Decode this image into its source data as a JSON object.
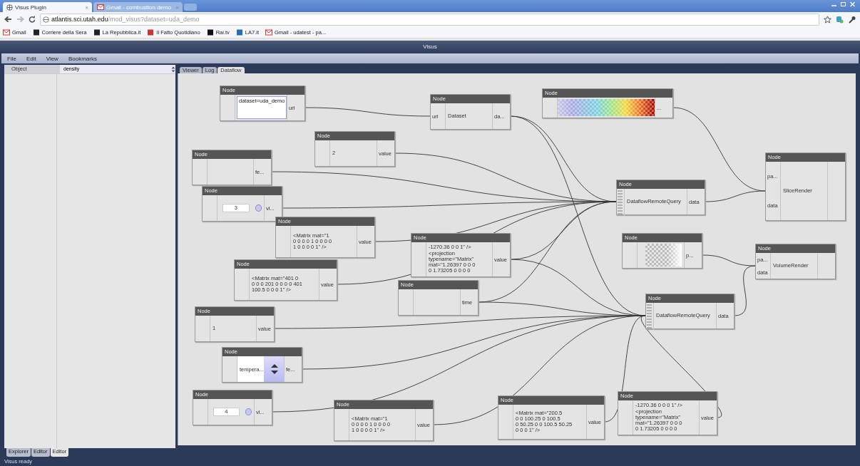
{
  "browser": {
    "tabs": [
      {
        "title": "Visus Plugin",
        "close": "×",
        "selected": true
      },
      {
        "title": "Gmail - combustion demo",
        "close": "×",
        "selected": false
      }
    ],
    "url": {
      "host": "atlantis.sci.utah.edu",
      "path": "/mod_visus?dataset=uda_demo"
    },
    "bookmarks": [
      "Gmail",
      "Corriere della Sera",
      "La Repubblica.it",
      "Il Fatto Quotidiano",
      "Rai.tv",
      "LA7.it",
      "Gmail - udatest - pa..."
    ]
  },
  "app": {
    "title": "Visus",
    "menu": [
      "File",
      "Edit",
      "View",
      "Bookmarks"
    ],
    "sidebar": {
      "property": "Object",
      "value": "density",
      "tabs": [
        {
          "label": "Explorer",
          "selected": false
        },
        {
          "label": "Editor",
          "selected": false
        },
        {
          "label": "Editor",
          "selected": true
        }
      ]
    },
    "view_tabs": [
      {
        "label": "Viewer",
        "selected": false
      },
      {
        "label": "Log",
        "selected": false
      },
      {
        "label": "Dataflow",
        "selected": true
      }
    ],
    "nodes": [
      {
        "kind": "field",
        "title": "Node",
        "value": "dataset=uda_demo",
        "output": "url"
      },
      {
        "kind": "label",
        "title": "Node",
        "inputs": [
          "url"
        ],
        "text": "Dataset",
        "output": "da..."
      },
      {
        "kind": "colormap",
        "title": "Node",
        "output": "..."
      },
      {
        "kind": "label",
        "title": "Node",
        "text": "2",
        "output": "value"
      },
      {
        "kind": "label",
        "title": "Node",
        "output": "fe..."
      },
      {
        "kind": "number",
        "title": "Node",
        "value": "3",
        "output": "vl..."
      },
      {
        "kind": "label",
        "title": "Node",
        "text": "<Matrix mat=\"1\n0 0 0 0 1 0 0 0 0\n1 0 0 0 0 1\" />",
        "output": "value"
      },
      {
        "kind": "label",
        "title": "Node",
        "text": "-1270.36 0 0 1\" />\n<projection\ntypename=\"Matrix\"\nmat=\"1.26397 0 0 0\n0 1.73205 0 0 0 0",
        "output": "value"
      },
      {
        "kind": "label",
        "title": "Node",
        "text": "<Matrix mat=\"401 0\n0 0 0 201 0 0 0 0 401\n100.5 0 0 0 1\" />",
        "output": "value"
      },
      {
        "kind": "label",
        "title": "Node",
        "output": "time"
      },
      {
        "kind": "query",
        "title": "Node",
        "text": "DataflowRemoteQuery",
        "output": "data"
      },
      {
        "kind": "label",
        "title": "Node",
        "inputs": [
          "pa...",
          "data"
        ],
        "text": "SliceRender"
      },
      {
        "kind": "transfer",
        "title": "Node",
        "output": "p..."
      },
      {
        "kind": "label",
        "title": "Node",
        "inputs": [
          "pa...",
          "data"
        ],
        "text": "VolumeRender"
      },
      {
        "kind": "query",
        "title": "Node",
        "text": "DataflowRemoteQuery",
        "output": "data"
      },
      {
        "kind": "label",
        "title": "Node",
        "text": "1",
        "output": "value"
      },
      {
        "kind": "dropdown",
        "title": "Node",
        "value": "tempera...",
        "output": "fe..."
      },
      {
        "kind": "number",
        "title": "Node",
        "value": "4",
        "output": "vl..."
      },
      {
        "kind": "label",
        "title": "Node",
        "text": "<Matrix mat=\"1\n0 0 0 0 1 0 0 0 0\n1 0 0 0 0 1\" />",
        "output": "value"
      },
      {
        "kind": "label",
        "title": "Node",
        "text": "<Matrix mat=\"200.5\n0 0 100.25 0 100.5\n0 50.25 0 0 100.5 50.25\n0 0 0 1\" />",
        "output": "value"
      },
      {
        "kind": "label",
        "title": "Node",
        "text": "-1270.36 0 0 0 1\" />\n<projection\ntypename=\"Matrix\"\nmat=\"1.26397 0 0 0\n0 1.73205 0 0 0 0",
        "output": "value"
      }
    ],
    "status_bar": "Visus ready"
  }
}
